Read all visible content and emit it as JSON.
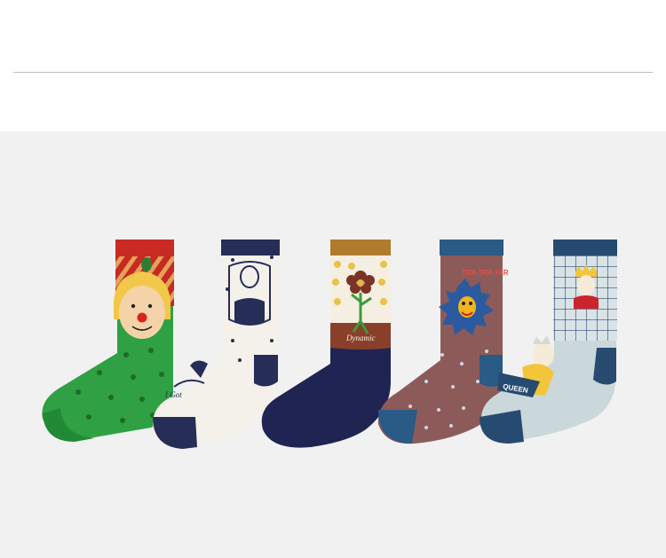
{
  "page": {
    "background": "#ffffff",
    "panel_color": "#f1f1f1",
    "divider_color": "#bdbdbd"
  },
  "photo": {
    "subject": "five-pairs-of-illustrated-crew-socks",
    "socks": [
      {
        "id": "clown",
        "cuff_color": "#c92a24",
        "body_color": "#2fa043",
        "motif": "clown-face",
        "text": ""
      },
      {
        "id": "doll",
        "cuff_color": "#262d57",
        "body_color": "#f3f1ea",
        "motif": "nesting-doll",
        "text": "I Got"
      },
      {
        "id": "flower",
        "cuff_color": "#b07b2c",
        "body_color": "#1f2452",
        "motif": "dancing-flower",
        "text": "Dynamic"
      },
      {
        "id": "monster",
        "cuff_color": "#2a5a86",
        "body_color": "#8d5a5a",
        "motif": "blue-monster",
        "text": "TRA TRA TAR"
      },
      {
        "id": "queen",
        "cuff_color": "#274b70",
        "body_color": "#cad7db",
        "motif": "queen-portrait",
        "text": "QUEEN"
      }
    ]
  }
}
